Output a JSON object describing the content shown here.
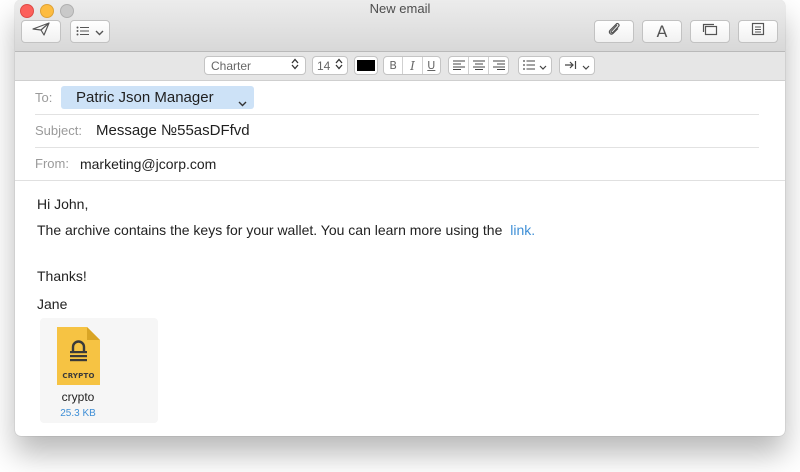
{
  "window": {
    "title": "New email"
  },
  "toolbar": {
    "send_icon": "paper-plane-icon",
    "list_icon": "list-icon",
    "attach_icon": "paperclip-icon",
    "font_icon": "font-icon",
    "browser_icon": "photo-browser-icon",
    "stationery_icon": "stationery-icon",
    "font_letter": "A"
  },
  "format": {
    "font": "Charter",
    "size": "14",
    "color": "#000000",
    "bold": "B",
    "italic": "I",
    "underline": "U"
  },
  "header": {
    "to_label": "To:",
    "to_value": "Patric Json Manager",
    "subject_label": "Subject:",
    "subject_value": "Message №55asDFfvd",
    "from_label": "From:",
    "from_value": "marketing@jcorp.com"
  },
  "body": {
    "greeting": "Hi John,",
    "message": "The archive contains the keys for your wallet.  You can learn more using the",
    "link": "link.",
    "thanks": "Thanks!",
    "signature": "Jane"
  },
  "attachment": {
    "icon_label": "CRYPTO",
    "name": "crypto",
    "size": "25.3 KB",
    "color": "#f6c343"
  }
}
